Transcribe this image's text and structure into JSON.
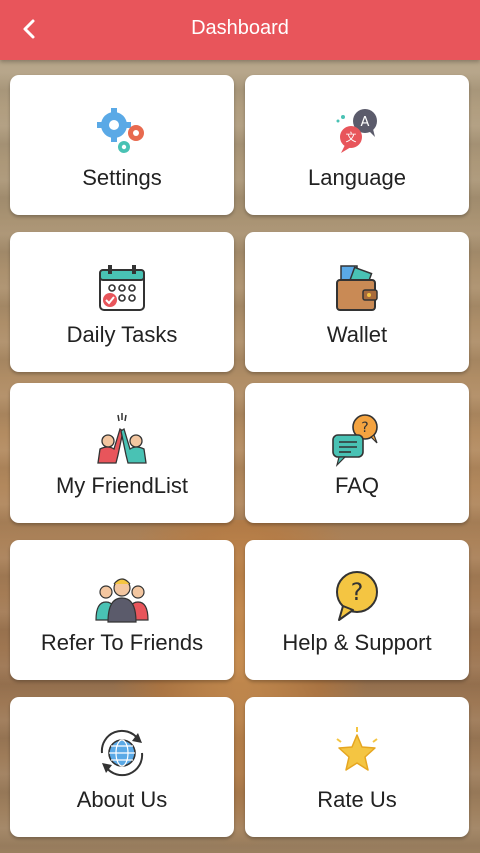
{
  "header": {
    "title": "Dashboard",
    "back_icon": "chevron-left-icon"
  },
  "menu": [
    {
      "label": "Settings",
      "icon": "gears-icon"
    },
    {
      "label": "Language",
      "icon": "translate-bubbles-icon"
    },
    {
      "label": "Daily Tasks",
      "icon": "calendar-check-icon"
    },
    {
      "label": "Wallet",
      "icon": "wallet-icon"
    },
    {
      "label": "My FriendList",
      "icon": "high-five-icon"
    },
    {
      "label": "FAQ",
      "icon": "faq-bubbles-icon"
    },
    {
      "label": "Refer To Friends",
      "icon": "group-people-icon"
    },
    {
      "label": "Help & Support",
      "icon": "help-bubble-icon"
    },
    {
      "label": "About Us",
      "icon": "globe-sync-icon"
    },
    {
      "label": "Rate Us",
      "icon": "star-icon"
    }
  ],
  "colors": {
    "header": "#e8555b",
    "card": "#ffffff"
  }
}
